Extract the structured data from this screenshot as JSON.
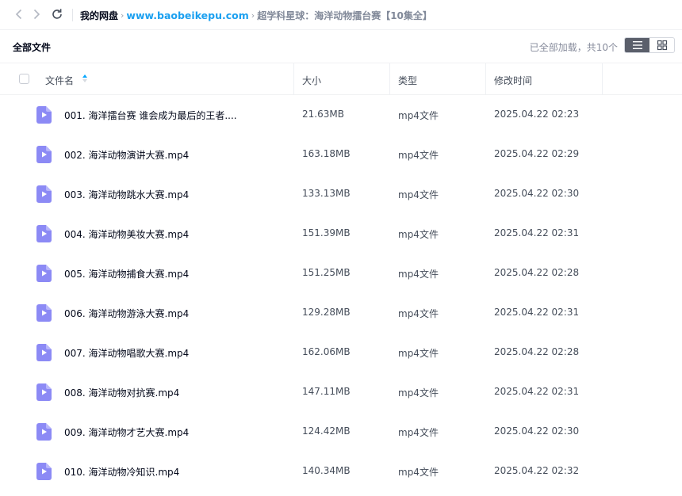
{
  "breadcrumb": {
    "root": "我的网盘",
    "watermark": "www.baobeikepu.com",
    "current": "超学科星球：海洋动物擂台赛【10集全】"
  },
  "toolbar": {
    "title": "全部文件",
    "load_status": "已全部加载，共10个"
  },
  "table": {
    "headers": {
      "name": "文件名",
      "size": "大小",
      "type": "类型",
      "modified": "修改时间"
    },
    "rows": [
      {
        "name": "001. 海洋擂台赛 谁会成为最后的王者....",
        "size": "21.63MB",
        "type": "mp4文件",
        "modified": "2025.04.22 02:23"
      },
      {
        "name": "002. 海洋动物演讲大赛.mp4",
        "size": "163.18MB",
        "type": "mp4文件",
        "modified": "2025.04.22 02:29"
      },
      {
        "name": "003. 海洋动物跳水大赛.mp4",
        "size": "133.13MB",
        "type": "mp4文件",
        "modified": "2025.04.22 02:30"
      },
      {
        "name": "004. 海洋动物美妆大赛.mp4",
        "size": "151.39MB",
        "type": "mp4文件",
        "modified": "2025.04.22 02:31"
      },
      {
        "name": "005. 海洋动物捕食大赛.mp4",
        "size": "151.25MB",
        "type": "mp4文件",
        "modified": "2025.04.22 02:28"
      },
      {
        "name": "006. 海洋动物游泳大赛.mp4",
        "size": "129.28MB",
        "type": "mp4文件",
        "modified": "2025.04.22 02:31"
      },
      {
        "name": "007. 海洋动物唱歌大赛.mp4",
        "size": "162.06MB",
        "type": "mp4文件",
        "modified": "2025.04.22 02:28"
      },
      {
        "name": "008. 海洋动物对抗赛.mp4",
        "size": "147.11MB",
        "type": "mp4文件",
        "modified": "2025.04.22 02:31"
      },
      {
        "name": "009. 海洋动物才艺大赛.mp4",
        "size": "124.42MB",
        "type": "mp4文件",
        "modified": "2025.04.22 02:30"
      },
      {
        "name": "010. 海洋动物冷知识.mp4",
        "size": "140.34MB",
        "type": "mp4文件",
        "modified": "2025.04.22 02:32"
      }
    ]
  },
  "icons": {
    "back": "chevron-left-icon",
    "forward": "chevron-right-icon",
    "refresh": "refresh-icon",
    "sort": "sort-asc-icon",
    "list_view": "list-view-icon",
    "grid_view": "grid-view-icon",
    "file": "video-file-icon"
  },
  "colors": {
    "accent": "#06a7ff",
    "watermark": "#1ba0f0",
    "video_icon": "#8c8af5",
    "active_view": "#5b5f6b"
  }
}
